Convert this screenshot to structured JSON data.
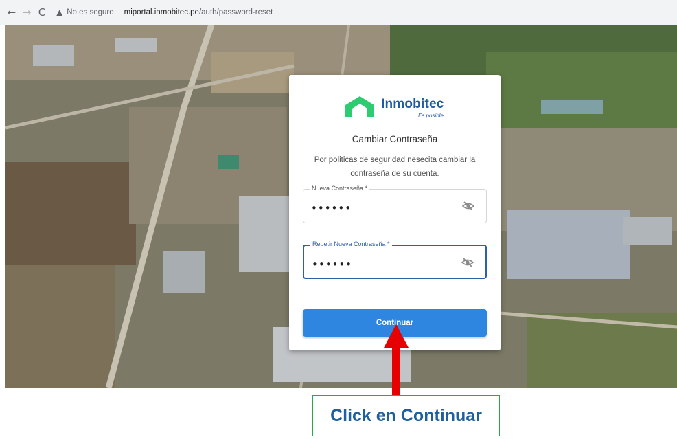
{
  "browser": {
    "back_icon": "arrow-left-icon",
    "forward_icon": "arrow-right-icon",
    "reload_icon": "reload-icon",
    "security_label": "No es seguro",
    "url_host": "miportal.inmobitec.pe",
    "url_path": "/auth/password-reset"
  },
  "card": {
    "brand_name": "Inmobitec",
    "brand_tagline": "Es posible",
    "title": "Cambiar Contraseña",
    "description": "Por politicas de seguridad nesecita cambiar la contraseña de su cuenta.",
    "new_password": {
      "label": "Nueva Contraseña *",
      "value": "••••••"
    },
    "repeat_password": {
      "label": "Repetir Nueva Contraseña *",
      "value": "••••••"
    },
    "submit_label": "Continuar"
  },
  "annotation": {
    "text": "Click en Continuar"
  },
  "colors": {
    "brand_green": "#2ecc71",
    "brand_blue": "#1f5aa5",
    "button_blue": "#2f86e0",
    "arrow_red": "#e60000"
  }
}
